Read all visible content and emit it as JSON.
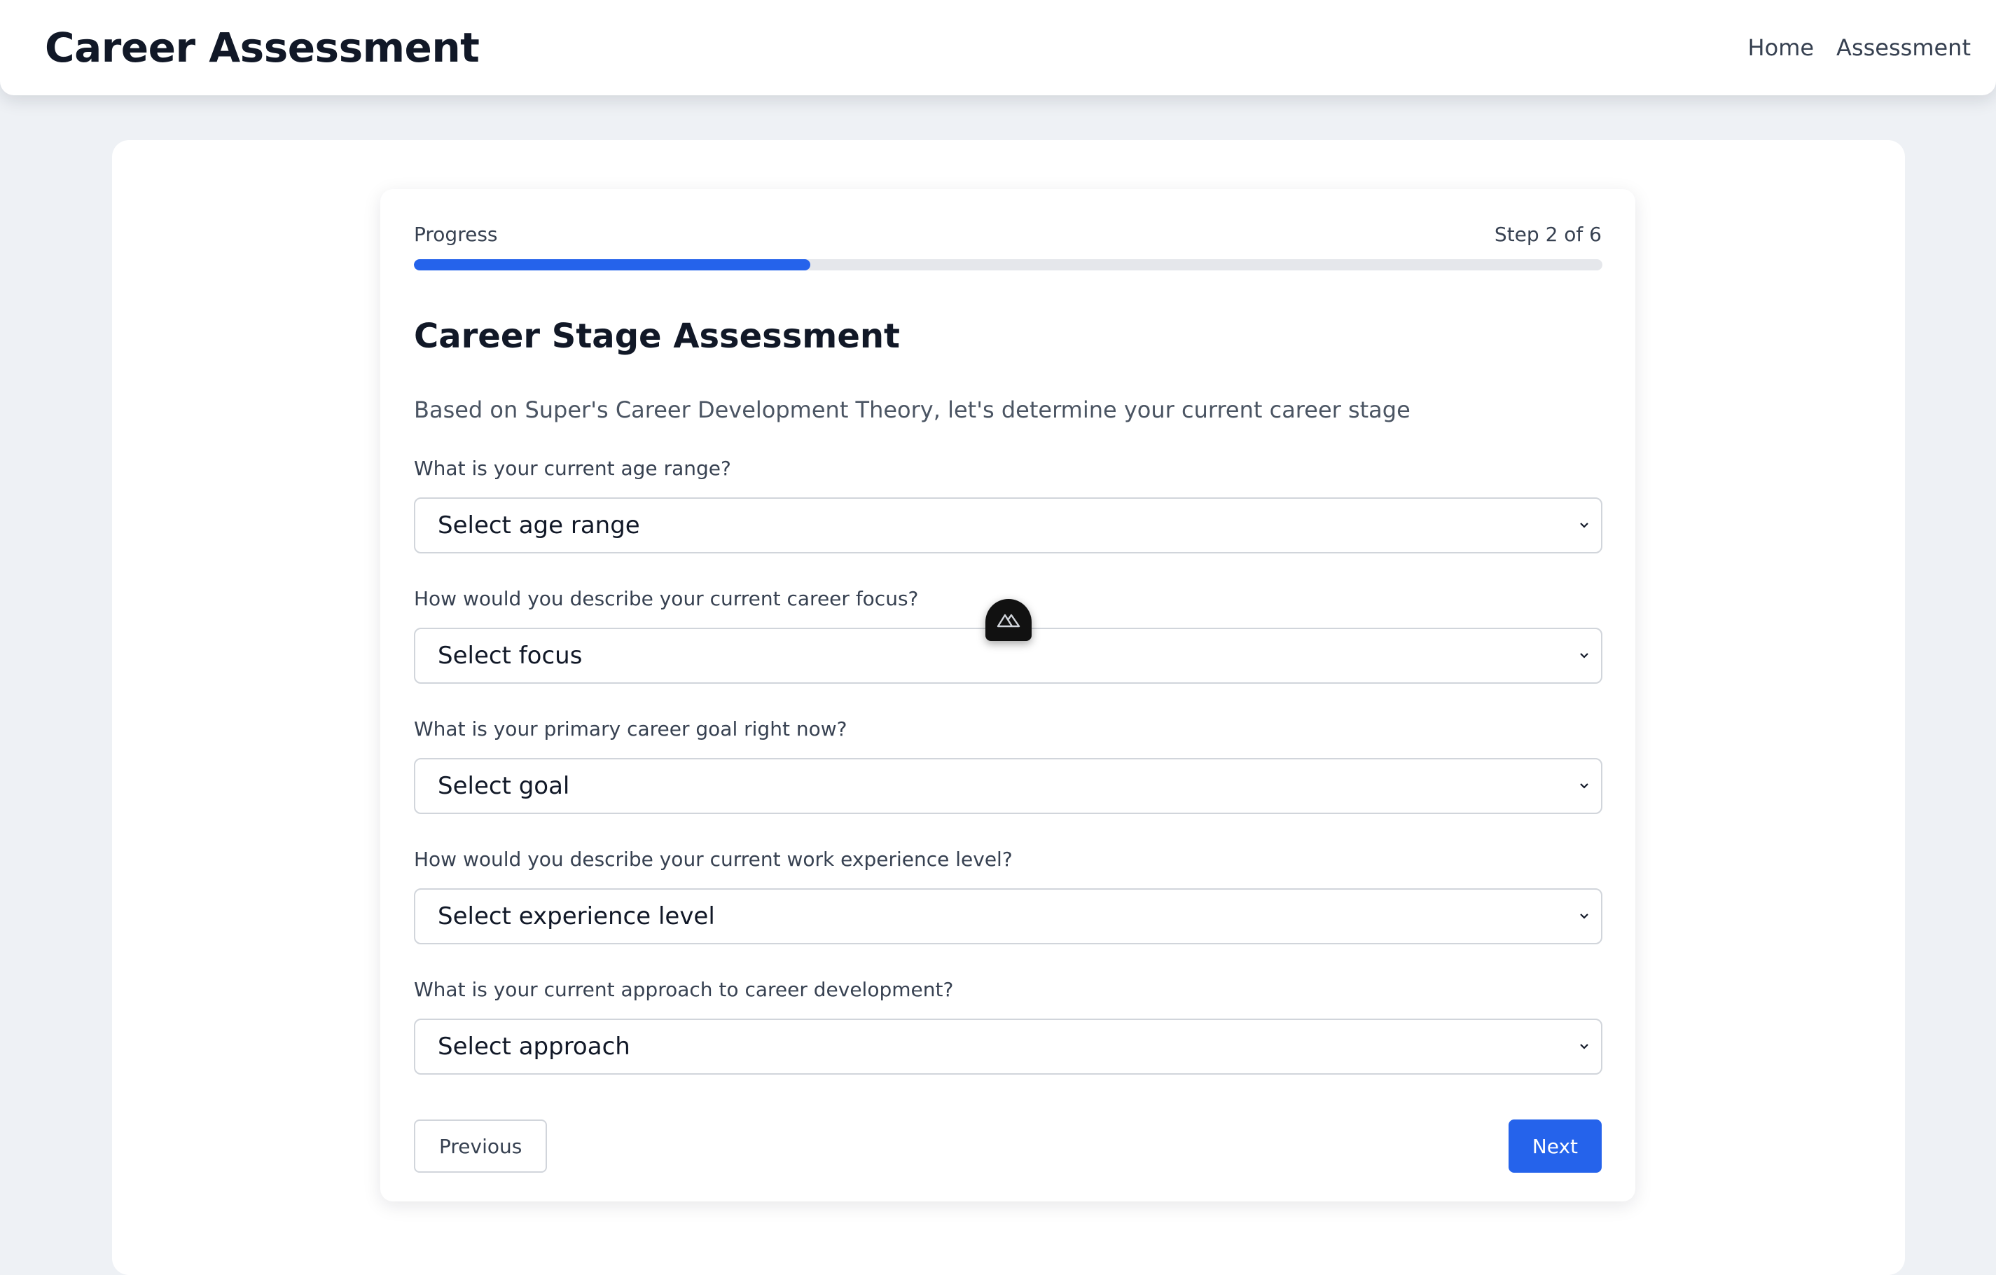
{
  "header": {
    "title": "Career Assessment",
    "nav": [
      "Home",
      "Assessment"
    ]
  },
  "progress": {
    "label": "Progress",
    "step_text": "Step 2 of 6",
    "fraction": 0.3333
  },
  "section": {
    "title": "Career Stage Assessment",
    "description": "Based on Super's Career Development Theory, let's determine your current career stage"
  },
  "questions": [
    {
      "label": "What is your current age range?",
      "selected": "Select age range"
    },
    {
      "label": "How would you describe your current career focus?",
      "selected": "Select focus"
    },
    {
      "label": "What is your primary career goal right now?",
      "selected": "Select goal"
    },
    {
      "label": "How would you describe your current work experience level?",
      "selected": "Select experience level"
    },
    {
      "label": "What is your current approach to career development?",
      "selected": "Select approach"
    }
  ],
  "actions": {
    "previous": "Previous",
    "next": "Next"
  },
  "icons": {
    "select_arrow": "chevron-down-icon",
    "floating_badge": "mountain-logo-icon"
  },
  "colors": {
    "accent": "#2563eb",
    "track": "#e5e7eb",
    "background": "#eef1f5"
  }
}
